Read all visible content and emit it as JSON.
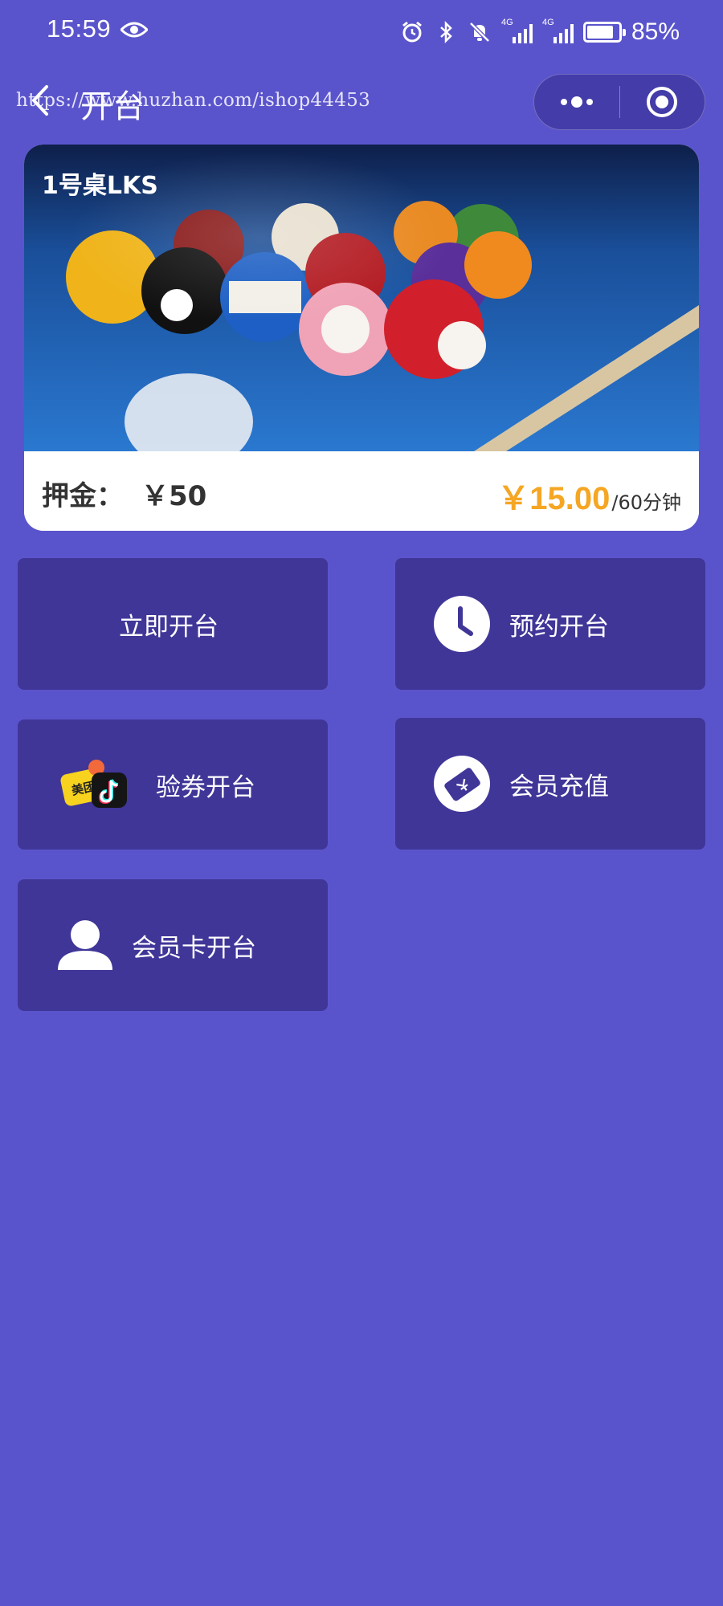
{
  "status_bar": {
    "time": "15:59",
    "network_1": "4G",
    "network_2": "4G",
    "battery_level": 0.85,
    "battery_text": "85%"
  },
  "nav": {
    "title": "开台",
    "watermark": "https://www.huzhan.com/ishop44453"
  },
  "table": {
    "name": "1号桌LKS",
    "deposit_label": "押金：",
    "deposit_value": "￥50",
    "price": "￥15.00",
    "price_unit": "/60分钟"
  },
  "actions": {
    "open_now": "立即开台",
    "reserve": "预约开台",
    "voucher": "验券开台",
    "recharge": "会员充值",
    "member_card": "会员卡开台",
    "meituan_badge": "美团"
  },
  "colors": {
    "background": "#5a54cc",
    "button": "#403698",
    "price": "#f5a623"
  },
  "icons": {
    "clock": "clock-icon",
    "card": "membership-card-icon",
    "user": "user-icon",
    "voucher": "meituan-douyin-icon"
  }
}
